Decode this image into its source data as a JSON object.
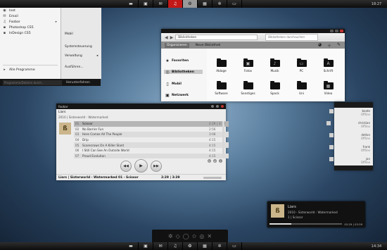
{
  "taskbar_top": {
    "icons": [
      "folder-icon",
      "image-icon",
      "mail-icon",
      "headphones-icon",
      "chat-icon",
      "film-icon",
      "gear-icon",
      "display-icon"
    ],
    "clock": "18:27",
    "active_index": 3,
    "selected_index": 4
  },
  "taskbar_bottom": {
    "icons": [
      "folder-icon",
      "image-icon",
      "mail-icon",
      "headphones-icon",
      "chat-icon",
      "film-icon",
      "gear-icon",
      "display-icon"
    ],
    "clock": "14:34"
  },
  "start_menu": {
    "left_items": [
      {
        "label": "Inet",
        "icon": "globe-icon"
      },
      {
        "label": "Email",
        "icon": "mail-icon"
      },
      {
        "label": "Foobar",
        "icon": "headphones-icon",
        "pinned": true
      },
      {
        "label": "Photoshop CS5",
        "icon": "app-icon"
      },
      {
        "label": "InDesign CS5",
        "icon": "app-icon"
      }
    ],
    "all_programs": "Alle Programme",
    "right_items": [
      {
        "label": "Mobil",
        "arrow": false
      },
      {
        "label": "Systemsteuerung",
        "arrow": false
      },
      {
        "label": "Verwaltung",
        "arrow": true
      },
      {
        "label": "Ausführen...",
        "arrow": false
      }
    ],
    "search_placeholder": "Programme/Dateien durch...",
    "shutdown_label": "Herunterfahren"
  },
  "explorer": {
    "path": "Bibliotheken",
    "search_placeholder": "Bibliotheken durchsuchen",
    "toolbar": {
      "organize": "Organisieren",
      "new_library": "Neue Bibliothek"
    },
    "nav": [
      {
        "label": "Favoriten",
        "icon": "star-icon"
      },
      {
        "label": "Bibliotheken",
        "icon": "library-icon",
        "selected": true
      },
      {
        "label": "Mobil",
        "icon": "phone-icon"
      },
      {
        "label": "Netzwerk",
        "icon": "network-icon"
      }
    ],
    "folders": [
      {
        "label": "Ablage",
        "icon": "folder-icon"
      },
      {
        "label": "Fotos",
        "icon": "image-icon"
      },
      {
        "label": "Musik",
        "icon": "music-icon"
      },
      {
        "label": "PC",
        "icon": "computer-icon"
      },
      {
        "label": "Schrift",
        "icon": "font-icon"
      },
      {
        "label": "Software",
        "icon": "folder-icon"
      },
      {
        "label": "Sonstiges",
        "icon": "folder-icon"
      },
      {
        "label": "Spock",
        "icon": "folder-icon"
      },
      {
        "label": "Uni",
        "icon": "folder-icon"
      },
      {
        "label": "Video",
        "icon": "film-icon"
      }
    ]
  },
  "player": {
    "title": "foobar",
    "artist": "Liars",
    "album": "2010 | Sisterworld - Watermarked",
    "time": "2:29 | 3:39",
    "tracks": [
      {
        "num": "01",
        "name": "Scissor",
        "dur": "3:39",
        "selected": true
      },
      {
        "num": "02",
        "name": "No Barrier Fun",
        "dur": "2:56"
      },
      {
        "num": "03",
        "name": "Here Comes All The People",
        "dur": "3:08"
      },
      {
        "num": "04",
        "name": "Drip",
        "dur": "4:15"
      },
      {
        "num": "05",
        "name": "Scarecrows On A Killer Slant",
        "dur": "4:15"
      },
      {
        "num": "06",
        "name": "I Still Can See An Outside World",
        "dur": "4:15"
      },
      {
        "num": "07",
        "name": "Proud Evolution",
        "dur": "4:15"
      }
    ],
    "status_left": "Liars | Sisterworld - Watermarked  01 - Scissor",
    "status_time": "2:29 | 3:39"
  },
  "contacts": [
    {
      "name": "beate",
      "status": "Offline"
    },
    {
      "name": "christian",
      "status": "Offline"
    },
    {
      "name": "detlon",
      "status": "Offline"
    },
    {
      "name": "frank",
      "status": "Offline"
    },
    {
      "name": "jan",
      "status": "Offline"
    }
  ],
  "notification": {
    "artist": "Liars",
    "album": "2010 - Sisterworld - Watermarked",
    "track": "1 | Scissor",
    "time": "02:29 | 03:39",
    "progress": 0.3
  },
  "dock": {
    "icons": [
      "cog-icon",
      "tag-icon",
      "circle-icon",
      "star-icon",
      "target-icon",
      "x-icon"
    ]
  }
}
